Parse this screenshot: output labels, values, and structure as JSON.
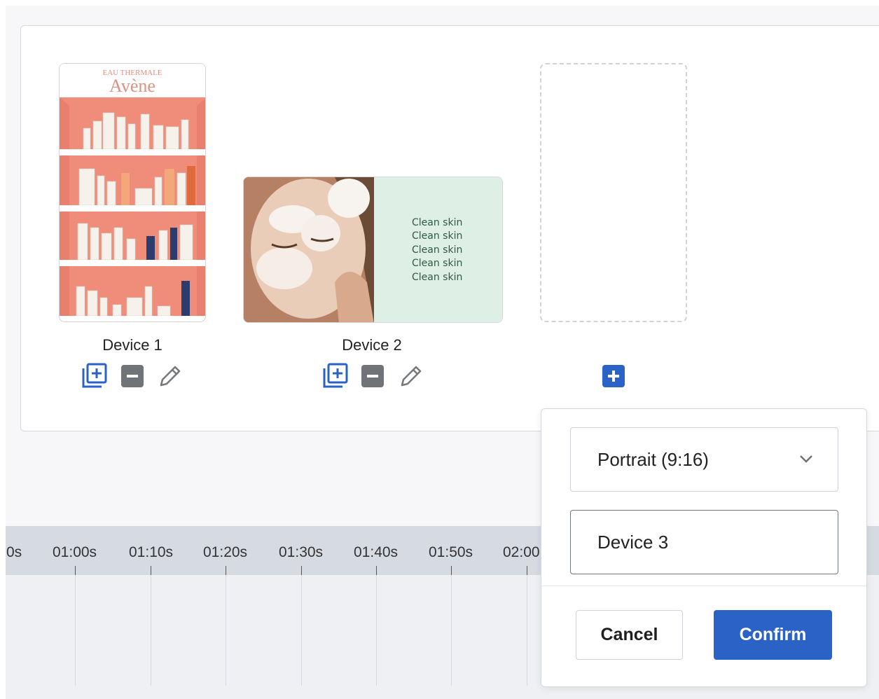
{
  "devices": [
    {
      "label": "Device 1",
      "brand_top": "EAU THERMALE",
      "brand_name": "Avène"
    },
    {
      "label": "Device 2",
      "promo_lines": [
        "Clean skin",
        "Clean skin",
        "Clean skin",
        "Clean skin",
        "Clean skin"
      ]
    }
  ],
  "timeline": {
    "ticks": [
      "0s",
      "01:00s",
      "01:10s",
      "01:20s",
      "01:30s",
      "01:40s",
      "01:50s",
      "02:00"
    ]
  },
  "new_device": {
    "orientation_value": "Portrait (9:16)",
    "name_value": "Device 3",
    "cancel_label": "Cancel",
    "confirm_label": "Confirm"
  },
  "colors": {
    "accent": "#2b62c6",
    "shelf_background": "#f08c7a",
    "promo_background": "#deefe6",
    "promo_text": "#2f5a45"
  }
}
